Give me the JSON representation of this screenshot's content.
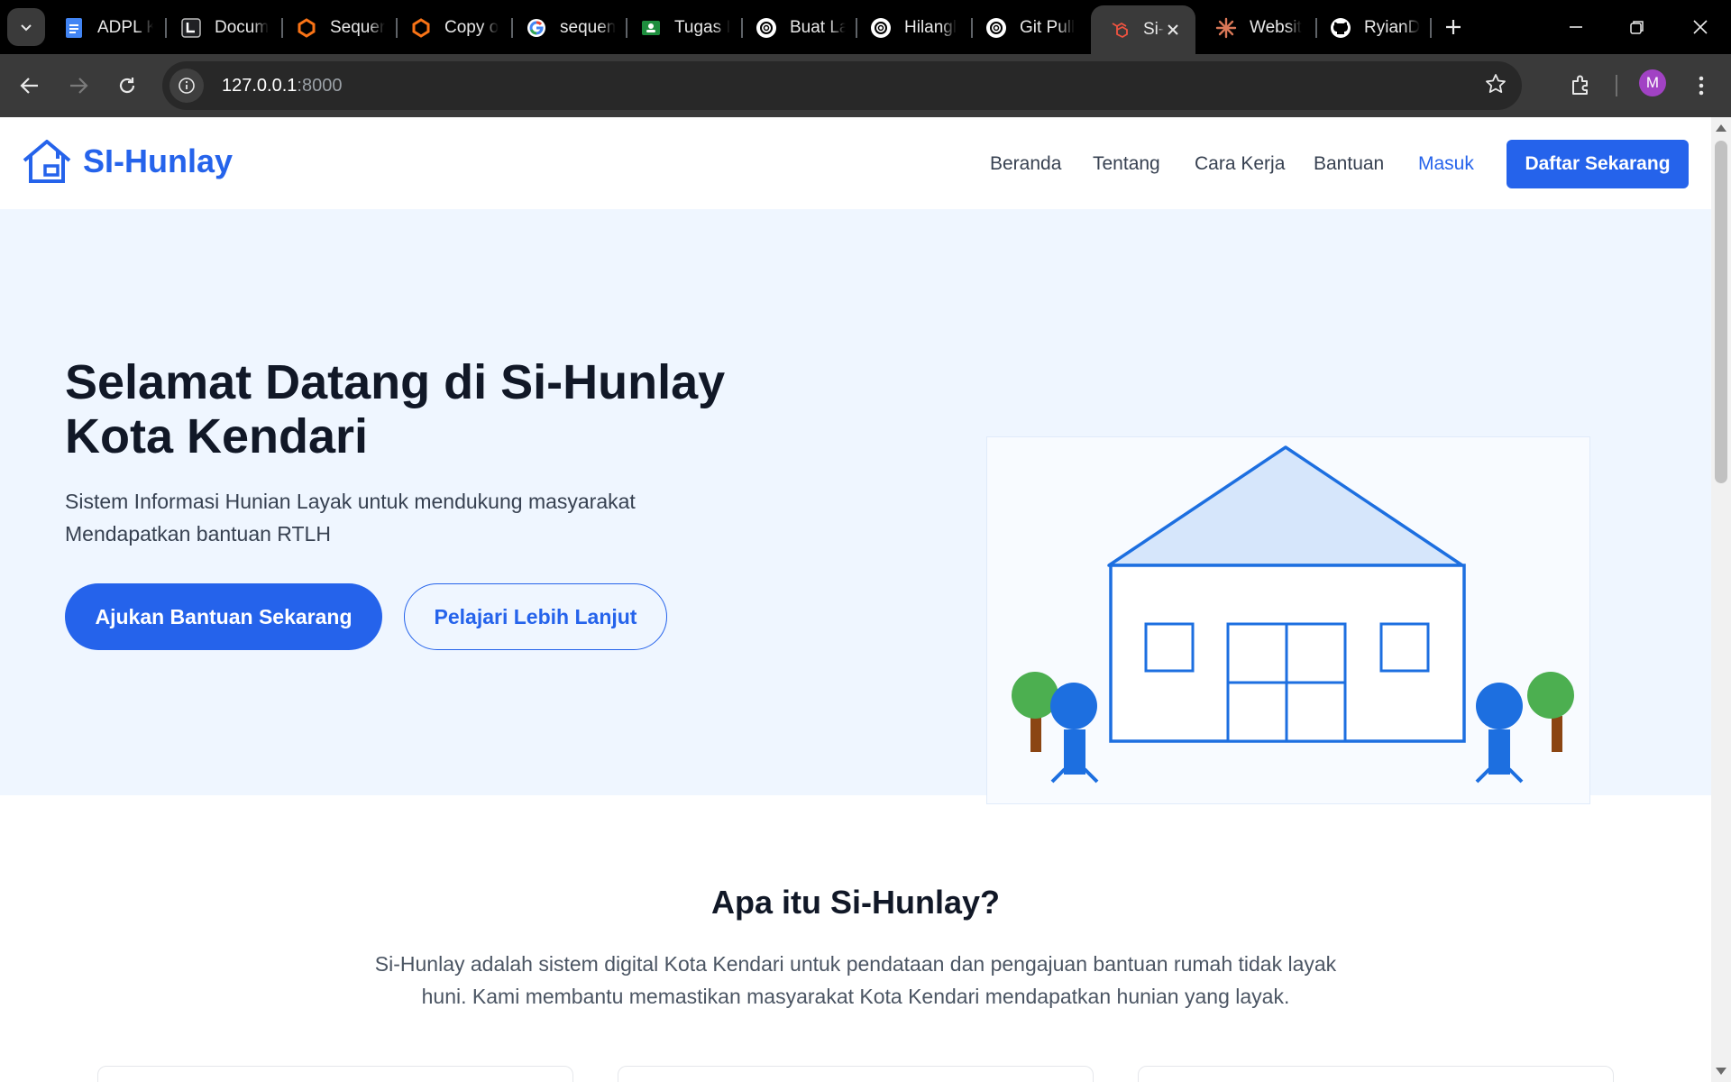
{
  "browser": {
    "tabs": [
      {
        "label": "ADPL K",
        "icon": "google-docs-icon"
      },
      {
        "label": "Docum",
        "icon": "document-icon"
      },
      {
        "label": "Sequer",
        "icon": "diagram-tool-icon"
      },
      {
        "label": "Copy o",
        "icon": "diagram-tool-icon"
      },
      {
        "label": "sequen",
        "icon": "google-icon"
      },
      {
        "label": "Tugas I",
        "icon": "classroom-icon"
      },
      {
        "label": "Buat La",
        "icon": "chatgpt-icon"
      },
      {
        "label": "Hilangl",
        "icon": "chatgpt-icon"
      },
      {
        "label": "Git Pull",
        "icon": "chatgpt-icon"
      },
      {
        "label": "Si-",
        "icon": "laravel-icon"
      },
      {
        "label": "Websit",
        "icon": "claude-icon"
      },
      {
        "label": "RyianD",
        "icon": "github-icon"
      }
    ],
    "url_host": "127.0.0.1",
    "url_port": ":8000",
    "profile_initial": "M"
  },
  "site": {
    "brand": "SI-Hunlay",
    "nav": [
      "Beranda",
      "Tentang",
      "Cara Kerja",
      "Bantuan"
    ],
    "login": "Masuk",
    "register": "Daftar Sekarang"
  },
  "hero": {
    "title_line1": "Selamat Datang di Si-Hunlay",
    "title_line2": "Kota Kendari",
    "subtitle_line1": "Sistem Informasi Hunian Layak untuk mendukung masyarakat",
    "subtitle_line2": "Mendapatkan bantuan RTLH",
    "primary_button": "Ajukan Bantuan Sekarang",
    "secondary_button": "Pelajari Lebih Lanjut"
  },
  "about": {
    "title": "Apa itu Si-Hunlay?",
    "text_line1": "Si-Hunlay adalah sistem digital Kota Kendari untuk pendataan dan pengajuan bantuan rumah tidak layak",
    "text_line2": "huni. Kami membantu memastikan masyarakat Kota Kendari mendapatkan hunian yang layak."
  },
  "colors": {
    "brand_blue": "#2563eb",
    "hero_bg": "#eff6ff",
    "tree_green": "#4caf50",
    "trunk_brown": "#8b4513"
  }
}
